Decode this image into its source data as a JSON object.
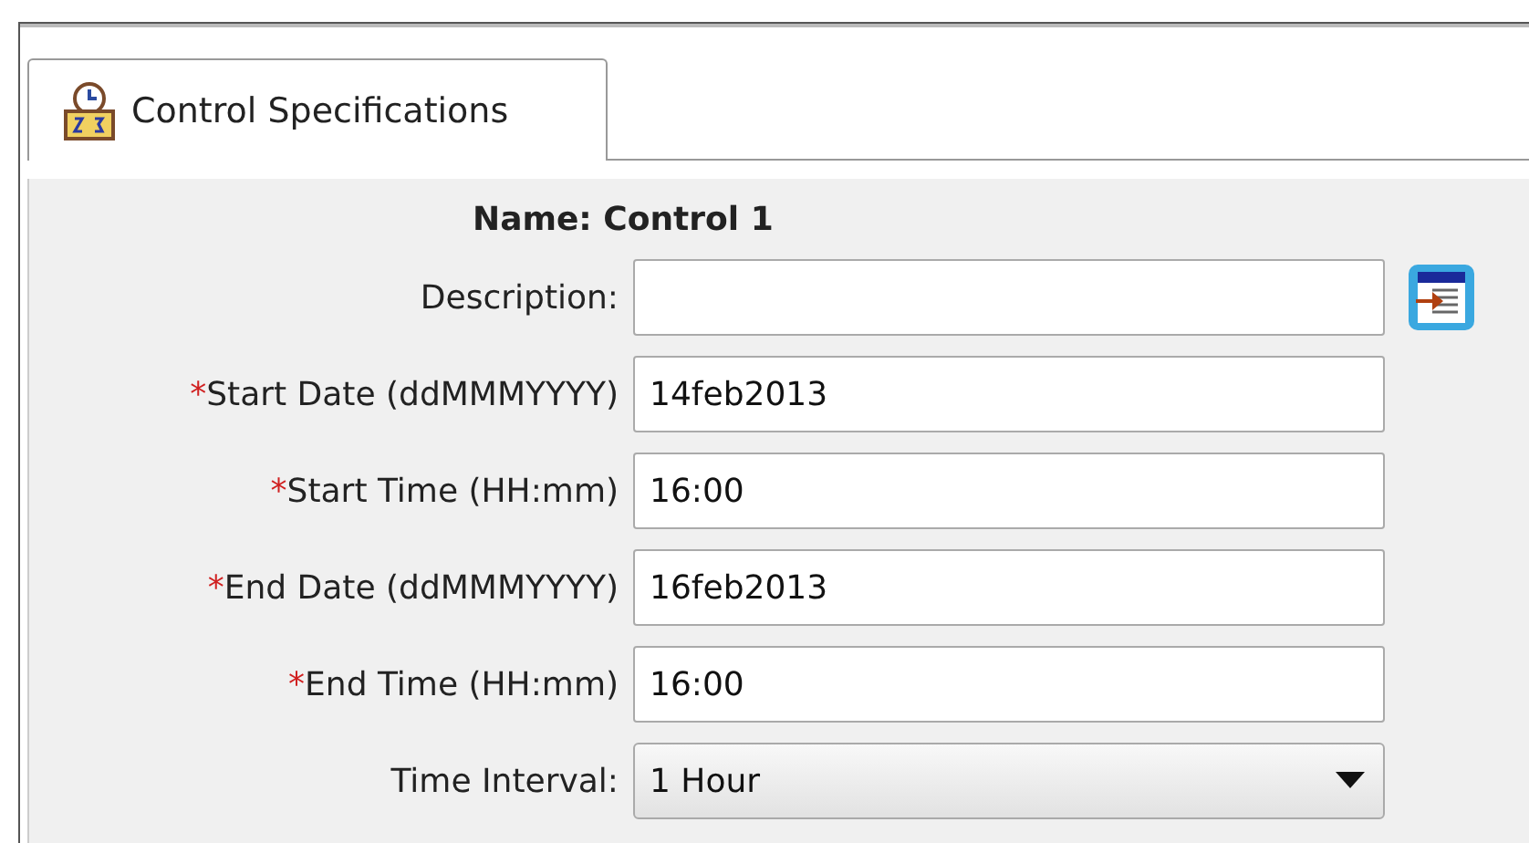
{
  "tabs": [
    {
      "label": "Control Specifications",
      "selected": true
    }
  ],
  "name": {
    "label": "Name:",
    "value": "Control 1"
  },
  "fields": [
    {
      "kind": "text",
      "label": "Description:",
      "required": false,
      "has_button": true
    },
    {
      "kind": "text",
      "label": "Start Date (ddMMMYYYY)",
      "required": true,
      "value": "14feb2013"
    },
    {
      "kind": "text",
      "label": "Start Time (HH:mm)",
      "required": true,
      "value": "16:00"
    },
    {
      "kind": "text",
      "label": "End Date (ddMMMYYYY)",
      "required": true,
      "value": "16feb2013"
    },
    {
      "kind": "text",
      "label": "End Time (HH:mm)",
      "required": true,
      "value": "16:00"
    },
    {
      "kind": "select",
      "label": "Time Interval:",
      "required": false,
      "value": "1 Hour"
    }
  ],
  "required_mark": "*"
}
